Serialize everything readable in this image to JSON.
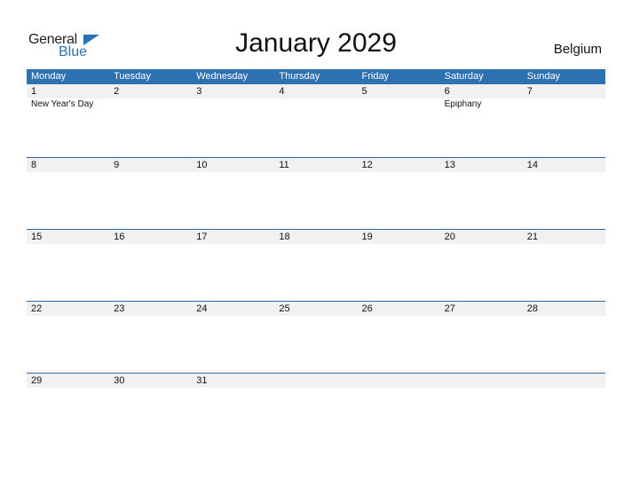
{
  "logo": {
    "general": "General",
    "blue": "Blue"
  },
  "title": "January 2029",
  "country": "Belgium",
  "weekdays": [
    "Monday",
    "Tuesday",
    "Wednesday",
    "Thursday",
    "Friday",
    "Saturday",
    "Sunday"
  ],
  "weeks": [
    {
      "days": [
        "1",
        "2",
        "3",
        "4",
        "5",
        "6",
        "7"
      ],
      "events": [
        "New Year's Day",
        "",
        "",
        "",
        "",
        "Epiphany",
        ""
      ]
    },
    {
      "days": [
        "8",
        "9",
        "10",
        "11",
        "12",
        "13",
        "14"
      ],
      "events": [
        "",
        "",
        "",
        "",
        "",
        "",
        ""
      ]
    },
    {
      "days": [
        "15",
        "16",
        "17",
        "18",
        "19",
        "20",
        "21"
      ],
      "events": [
        "",
        "",
        "",
        "",
        "",
        "",
        ""
      ]
    },
    {
      "days": [
        "22",
        "23",
        "24",
        "25",
        "26",
        "27",
        "28"
      ],
      "events": [
        "",
        "",
        "",
        "",
        "",
        "",
        ""
      ]
    },
    {
      "days": [
        "29",
        "30",
        "31",
        "",
        "",
        "",
        ""
      ],
      "events": [
        "",
        "",
        "",
        "",
        "",
        "",
        ""
      ]
    }
  ],
  "colors": {
    "header": "#2e71b1",
    "accent": "#2a73b5",
    "dayband": "#f1f1f1"
  }
}
